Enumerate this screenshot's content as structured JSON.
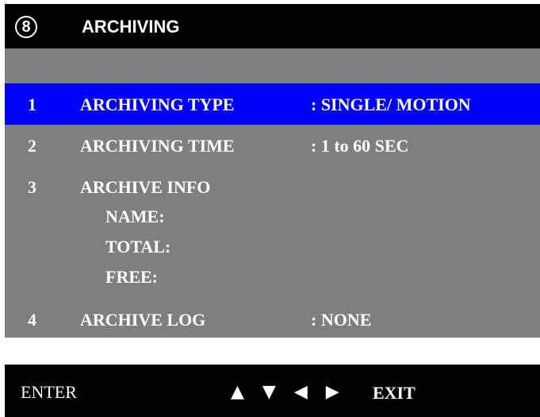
{
  "header": {
    "menu_number": "8",
    "title": "ARCHIVING"
  },
  "menu": {
    "items": [
      {
        "number": "1",
        "label": "ARCHIVING TYPE",
        "value": ": SINGLE/ MOTION",
        "selected": true
      },
      {
        "number": "2",
        "label": "ARCHIVING TIME",
        "value": ": 1 to 60 SEC",
        "selected": false
      },
      {
        "number": "3",
        "label": "ARCHIVE INFO",
        "value": "",
        "selected": false
      },
      {
        "number": "4",
        "label": "ARCHIVE LOG",
        "value": ": NONE",
        "selected": false
      }
    ],
    "archive_info_fields": [
      "NAME:",
      "TOTAL:",
      "FREE:"
    ]
  },
  "footer": {
    "enter_label": "ENTER",
    "arrows": "▲ ▼ ◀ ▶",
    "exit_label": "EXIT"
  },
  "colors": {
    "panel_background": "#7f7f7f",
    "header_background": "#000000",
    "selection_highlight": "#0000ff",
    "text": "#ffffff"
  }
}
